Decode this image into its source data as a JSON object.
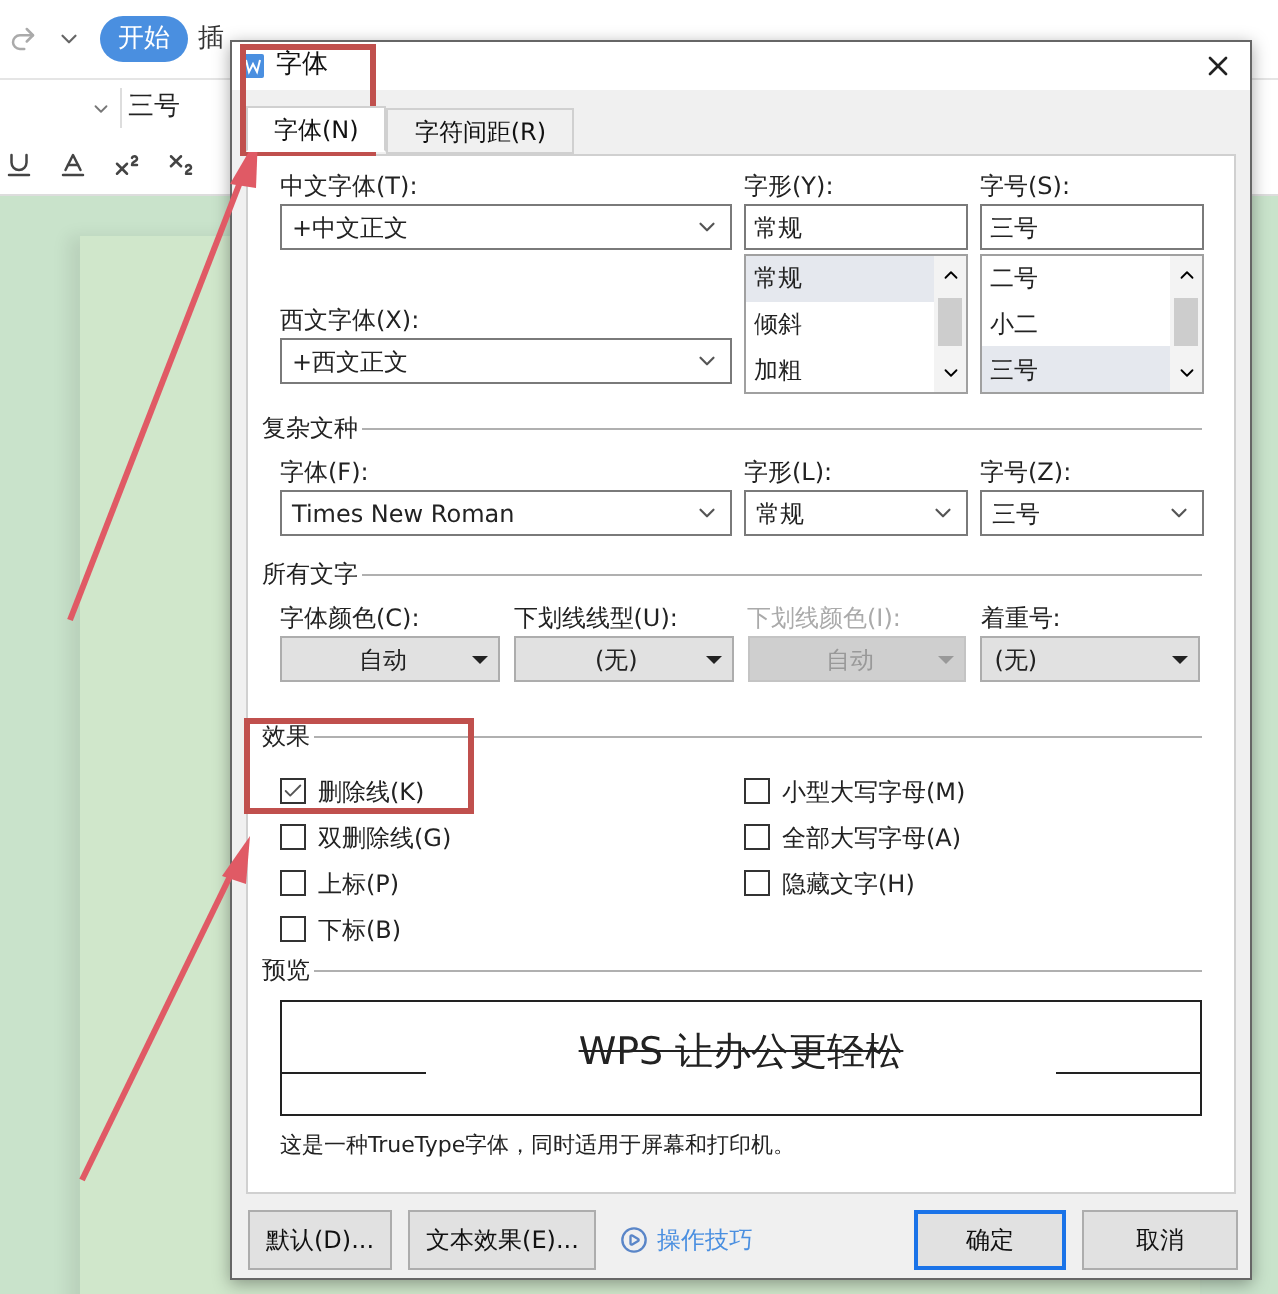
{
  "app": {
    "home_tab": "开始",
    "next_tab": "插",
    "size_box": "三号"
  },
  "dialog": {
    "title": "字体",
    "tabs": [
      {
        "label": "字体(N)",
        "selected": true
      },
      {
        "label": "字符间距(R)",
        "selected": false
      }
    ],
    "chinese_font": {
      "label": "中文字体(T):",
      "value": "+中文正文"
    },
    "western_font": {
      "label": "西文字体(X):",
      "value": "+西文正文"
    },
    "style": {
      "label": "字形(Y):",
      "value": "常规",
      "options": [
        {
          "text": "常规",
          "selected": true
        },
        {
          "text": "倾斜",
          "selected": false
        },
        {
          "text": "加粗",
          "selected": false
        }
      ]
    },
    "size": {
      "label": "字号(S):",
      "value": "三号",
      "options": [
        {
          "text": "二号",
          "selected": false
        },
        {
          "text": "小二",
          "selected": false
        },
        {
          "text": "三号",
          "selected": true
        }
      ]
    },
    "complex": {
      "title": "复杂文种",
      "fields": [
        {
          "label": "字体(F):",
          "value": "Times New Roman"
        },
        {
          "label": "字形(L):",
          "value": "常规"
        },
        {
          "label": "字号(Z):",
          "value": "三号"
        }
      ]
    },
    "all_text": {
      "title": "所有文字",
      "fields": [
        {
          "label": "字体颜色(C):",
          "value": "自动",
          "disabled": false
        },
        {
          "label": "下划线线型(U):",
          "value": "(无)",
          "disabled": false
        },
        {
          "label": "下划线颜色(I):",
          "value": "自动",
          "disabled": true
        },
        {
          "label": "着重号:",
          "value": "(无)",
          "disabled": false
        }
      ]
    },
    "effects": {
      "title": "效果",
      "left": [
        {
          "label": "删除线(K)",
          "checked": true
        },
        {
          "label": "双删除线(G)",
          "checked": false
        },
        {
          "label": "上标(P)",
          "checked": false
        },
        {
          "label": "下标(B)",
          "checked": false
        }
      ],
      "right": [
        {
          "label": "小型大写字母(M)",
          "checked": false
        },
        {
          "label": "全部大写字母(A)",
          "checked": false
        },
        {
          "label": "隐藏文字(H)",
          "checked": false
        }
      ]
    },
    "preview": {
      "title": "预览",
      "sample": "WPS 让办公更轻松",
      "note": "这是一种TrueType字体，同时适用于屏幕和打印机。"
    },
    "buttons": [
      "默认(D)...",
      "文本效果(E)..."
    ],
    "tips_link": "操作技巧",
    "ok": "确定",
    "cancel": "取消"
  }
}
